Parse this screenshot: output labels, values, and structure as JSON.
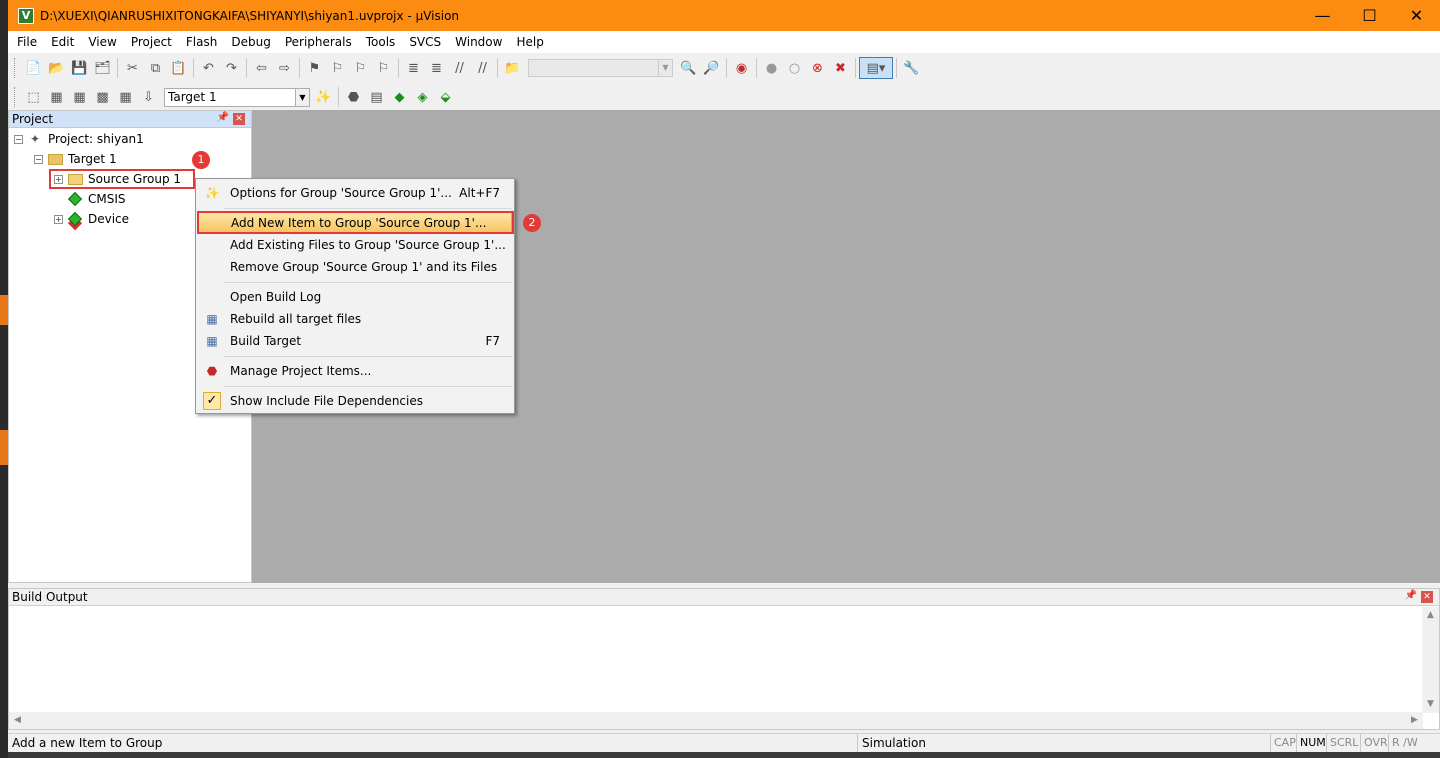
{
  "window": {
    "title": "D:\\XUEXI\\QIANRUSHIXITONGKAIFA\\SHIYANYI\\shiyan1.uvprojx - µVision",
    "app_icon_letter": "V",
    "minimize_glyph": "—",
    "maximize_glyph": "☐",
    "close_glyph": "✕",
    "titlebar_color": "#fb8b11"
  },
  "menubar": {
    "items": [
      "File",
      "Edit",
      "View",
      "Project",
      "Flash",
      "Debug",
      "Peripherals",
      "Tools",
      "SVCS",
      "Window",
      "Help"
    ]
  },
  "toolbar2": {
    "target_value": "Target 1"
  },
  "project_panel": {
    "title": "Project",
    "tree": {
      "project_label": "Project: shiyan1",
      "target_label": "Target 1",
      "source_group_label": "Source Group 1",
      "cmsis_label": "CMSIS",
      "device_label": "Device"
    }
  },
  "annotations": {
    "badge1": "1",
    "badge2": "2"
  },
  "context_menu": {
    "items": [
      {
        "label": "Options for Group 'Source Group 1'...",
        "shortcut": "Alt+F7"
      },
      {
        "label": "Add New  Item to Group 'Source Group 1'...",
        "shortcut": ""
      },
      {
        "label": "Add Existing Files to Group 'Source Group 1'...",
        "shortcut": ""
      },
      {
        "label": "Remove Group 'Source Group 1' and its Files",
        "shortcut": ""
      },
      {
        "label": "Open Build Log",
        "shortcut": ""
      },
      {
        "label": "Rebuild all target files",
        "shortcut": ""
      },
      {
        "label": "Build Target",
        "shortcut": "F7"
      },
      {
        "label": "Manage Project Items...",
        "shortcut": ""
      },
      {
        "label": "Show Include File Dependencies",
        "shortcut": ""
      }
    ]
  },
  "build_output": {
    "title": "Build Output"
  },
  "statusbar": {
    "message": "Add a new Item to Group",
    "mode": "Simulation",
    "cap": "CAP",
    "num": "NUM",
    "scrl": "SCRL",
    "ovr": "OVR",
    "rw": "R /W"
  }
}
